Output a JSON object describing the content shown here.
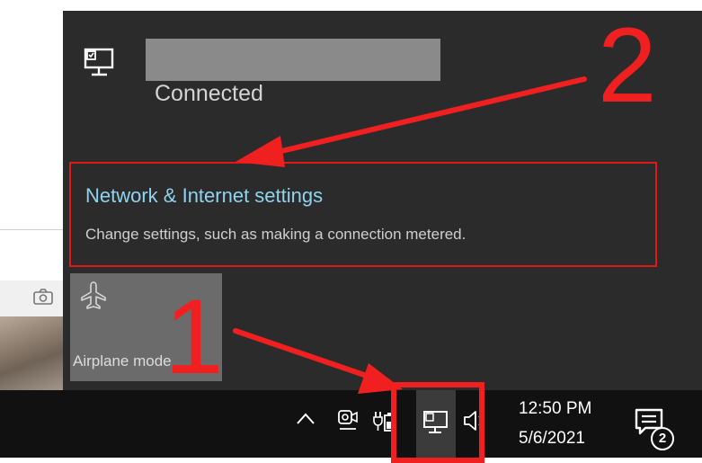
{
  "background": {
    "camera_icon": "camera-icon"
  },
  "flyout": {
    "network_icon": "desktop-network-icon",
    "network_name": "",
    "status": "Connected",
    "settings_link": {
      "title": "Network & Internet settings",
      "description": "Change settings, such as making a connection metered."
    },
    "quick_actions": [
      {
        "label": "Airplane mode",
        "icon": "airplane-icon",
        "enabled": false
      }
    ]
  },
  "taskbar": {
    "tray_icons": [
      "chevron-up-icon",
      "meet-now-icon",
      "power-plug-battery-icon",
      "desktop-network-icon",
      "volume-icon"
    ],
    "clock": {
      "time": "12:50 PM",
      "date": "5/6/2021"
    },
    "action_center": {
      "icon": "action-center-icon",
      "badge": "2"
    }
  },
  "annotations": [
    {
      "label": "1",
      "color": "#f02020"
    },
    {
      "label": "2",
      "color": "#f02020"
    }
  ],
  "colors": {
    "flyout_bg": "#2b2b2b",
    "link_accent": "#8fd3ee",
    "annotation_red": "#f02020",
    "taskbar_bg": "#111111"
  }
}
